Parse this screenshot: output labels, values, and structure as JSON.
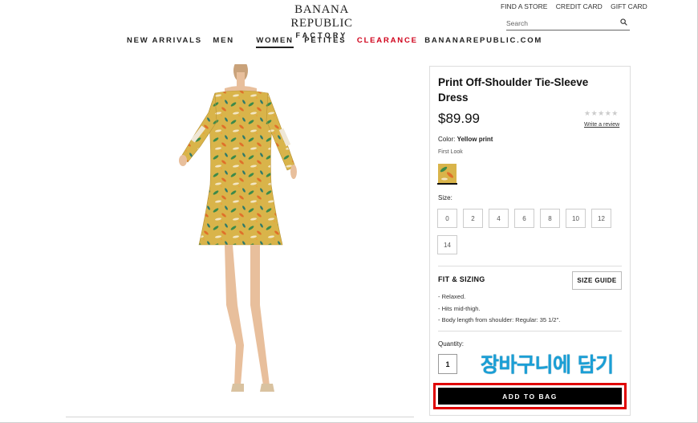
{
  "header": {
    "logo_line1": "BANANA REPUBLIC",
    "logo_line2": "FACTORY",
    "utility_links": [
      "FIND A STORE",
      "CREDIT CARD",
      "GIFT CARD"
    ],
    "search_placeholder": "Search"
  },
  "nav": {
    "items": [
      "NEW ARRIVALS",
      "MEN",
      "WOMEN",
      "PETITES",
      "CLEARANCE",
      "BANANAREPUBLIC.COM"
    ],
    "active": "WOMEN"
  },
  "product": {
    "title": "Print Off-Shoulder Tie-Sleeve Dress",
    "price": "$89.99",
    "rating_stars": "★★★★★",
    "review_link": "Write a review",
    "color_label": "Color:",
    "color_value": "Yellow print",
    "collection": "First Look",
    "size_label": "Size:",
    "sizes": [
      "0",
      "2",
      "4",
      "6",
      "8",
      "10",
      "12",
      "14"
    ],
    "fit_title": "FIT & SIZING",
    "size_guide_label": "SIZE GUIDE",
    "fit_details": [
      "Relaxed.",
      "Hits mid-thigh.",
      "Body length from shoulder: Regular: 35 1/2\"."
    ],
    "quantity_label": "Quantity:",
    "quantity_value": "1",
    "add_to_bag": "ADD TO BAG"
  },
  "annotation": {
    "text": "장바구니에 담기",
    "color": "#1a9fd6",
    "highlight_color": "#e00000"
  },
  "colors": {
    "clearance": "#d0021b",
    "dress_base": "#d9b44a"
  }
}
